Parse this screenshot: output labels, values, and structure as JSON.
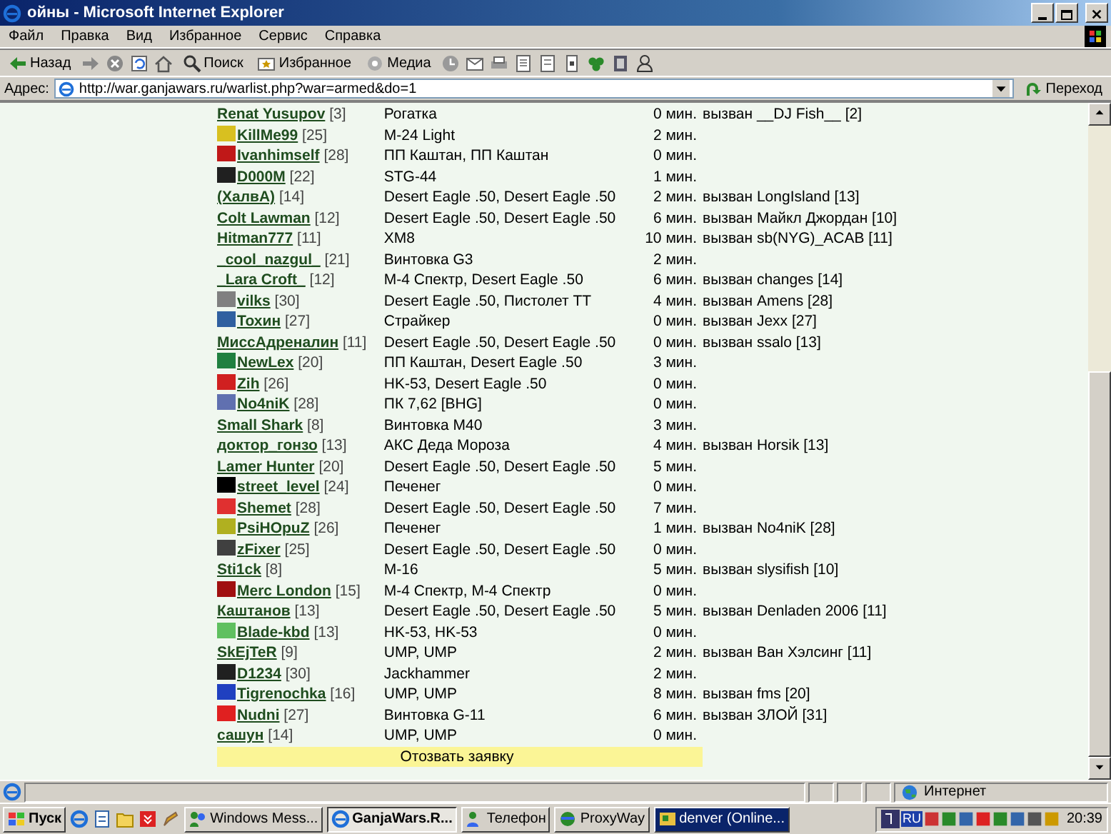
{
  "window": {
    "title": "ойны - Microsoft Internet Explorer"
  },
  "menu": [
    "Файл",
    "Правка",
    "Вид",
    "Избранное",
    "Сервис",
    "Справка"
  ],
  "toolbar": {
    "back": "Назад",
    "search": "Поиск",
    "favorites": "Избранное",
    "media": "Медиа"
  },
  "address": {
    "label": "Адрес:",
    "value": "http://war.ganjawars.ru/warlist.php?war=armed&do=1",
    "go": "Переход"
  },
  "rows": [
    {
      "name": "Renat Yusupov",
      "level": "[3]",
      "weapon": "Рогатка",
      "time": "0 мин.",
      "challenge": "вызван __DJ Fish__ [2]"
    },
    {
      "name": "KillMe99",
      "level": "[25]",
      "emblem": {
        "color": "#d8c020"
      },
      "weapon": "M-24 Light",
      "time": "2 мин."
    },
    {
      "name": "Ivanhimself",
      "level": "[28]",
      "emblem": {
        "color": "#c01818"
      },
      "weapon": "ПП Каштан, ПП Каштан",
      "time": "0 мин."
    },
    {
      "name": "D000M",
      "level": "[22]",
      "emblem": {
        "color": "#202020"
      },
      "weapon": "STG-44",
      "time": "1 мин."
    },
    {
      "name": "(ХалвА)",
      "level": "[14]",
      "weapon": "Desert Eagle .50, Desert Eagle .50",
      "time": "2 мин.",
      "challenge": "вызван LongIsland [13]"
    },
    {
      "name": "Colt Lawman",
      "level": "[12]",
      "weapon": "Desert Eagle .50, Desert Eagle .50",
      "time": "6 мин.",
      "challenge": "вызван Майкл Джордан [10]"
    },
    {
      "name": "Hitman777",
      "level": "[11]",
      "weapon": "XM8",
      "time": "10 мин.",
      "challenge": "вызван sb(NYG)_ACAB [11]"
    },
    {
      "name": "_cool_nazgul_",
      "level": "[21]",
      "weapon": "Винтовка G3",
      "time": "2 мин."
    },
    {
      "name": "_Lara Croft_",
      "level": "[12]",
      "weapon": "M-4 Спектр, Desert Eagle .50",
      "time": "6 мин.",
      "challenge": "вызван changes [14]"
    },
    {
      "name": "vilks",
      "level": "[30]",
      "emblem": {
        "color": "#808080"
      },
      "weapon": "Desert Eagle .50, Пистолет ТТ",
      "time": "4 мин.",
      "challenge": "вызван Amens [28]"
    },
    {
      "name": "Тохин",
      "level": "[27]",
      "emblem": {
        "color": "#3060a0"
      },
      "weapon": "Страйкер",
      "time": "0 мин.",
      "challenge": "вызван Jexx [27]"
    },
    {
      "name": "МиссАдреналин",
      "level": "[11]",
      "weapon": "Desert Eagle .50, Desert Eagle .50",
      "time": "0 мин.",
      "challenge": "вызван ssalo [13]"
    },
    {
      "name": "NewLex",
      "level": "[20]",
      "emblem": {
        "color": "#208040"
      },
      "weapon": "ПП Каштан, Desert Eagle .50",
      "time": "3 мин."
    },
    {
      "name": "Zih",
      "level": "[26]",
      "emblem": {
        "color": "#d02020"
      },
      "weapon": "HK-53, Desert Eagle .50",
      "time": "0 мин."
    },
    {
      "name": "No4niK",
      "level": "[28]",
      "emblem": {
        "color": "#6070b0"
      },
      "weapon": "ПК 7,62 [BHG]",
      "time": "0 мин."
    },
    {
      "name": "Small Shark",
      "level": "[8]",
      "weapon": "Винтовка M40",
      "time": "3 мин."
    },
    {
      "name": "доктор_гонзо",
      "level": "[13]",
      "weapon": "АКС Деда Мороза",
      "time": "4 мин.",
      "challenge": "вызван Horsik [13]"
    },
    {
      "name": "Lamer Hunter",
      "level": "[20]",
      "weapon": "Desert Eagle .50, Desert Eagle .50",
      "time": "5 мин."
    },
    {
      "name": "street_level",
      "level": "[24]",
      "emblem": {
        "color": "#000000"
      },
      "weapon": "Печенег",
      "time": "0 мин."
    },
    {
      "name": "Shemet",
      "level": "[28]",
      "emblem": {
        "color": "#e03030"
      },
      "weapon": "Desert Eagle .50, Desert Eagle .50",
      "time": "7 мин."
    },
    {
      "name": "PsiHOpuZ",
      "level": "[26]",
      "emblem": {
        "color": "#b0b020"
      },
      "weapon": "Печенег",
      "time": "1 мин.",
      "challenge": "вызван No4niK [28]"
    },
    {
      "name": "zFixer",
      "level": "[25]",
      "emblem": {
        "color": "#404040"
      },
      "weapon": "Desert Eagle .50, Desert Eagle .50",
      "time": "0 мин."
    },
    {
      "name": "Sti1ck",
      "level": "[8]",
      "weapon": "M-16",
      "time": "5 мин.",
      "challenge": "вызван slysifish [10]"
    },
    {
      "name": "Merc London",
      "level": "[15]",
      "emblem": {
        "color": "#a01010"
      },
      "weapon": "M-4 Спектр, M-4 Спектр",
      "time": "0 мин."
    },
    {
      "name": "Каштанов",
      "level": "[13]",
      "weapon": "Desert Eagle .50, Desert Eagle .50",
      "time": "5 мин.",
      "challenge": "вызван Denladen 2006 [11]"
    },
    {
      "name": "Blade-kbd",
      "level": "[13]",
      "emblem": {
        "color": "#60c060"
      },
      "weapon": "HK-53, HK-53",
      "time": "0 мин."
    },
    {
      "name": "SkEjTeR",
      "level": "[9]",
      "weapon": "UMP, UMP",
      "time": "2 мин.",
      "challenge": "вызван Ван Хэлсинг [11]"
    },
    {
      "name": "D1234",
      "level": "[30]",
      "emblem": {
        "color": "#202020"
      },
      "weapon": "Jackhammer",
      "time": "2 мин."
    },
    {
      "name": "Tigrenochka",
      "level": "[16]",
      "emblem": {
        "color": "#2040c0"
      },
      "weapon": "UMP, UMP",
      "time": "8 мин.",
      "challenge": "вызван fms [20]"
    },
    {
      "name": "Nudni",
      "level": "[27]",
      "emblem": {
        "color": "#e02020"
      },
      "weapon": "Винтовка G-11",
      "time": "6 мин.",
      "challenge": "вызван ЗЛОЙ [31]"
    },
    {
      "name": "сашун",
      "level": "[14]",
      "weapon": "UMP, UMP",
      "time": "0 мин."
    }
  ],
  "withdraw_link": "Отозвать заявку",
  "status_bar": {
    "zone": "Интернет"
  },
  "taskbar": {
    "start": "Пуск",
    "tasks": [
      {
        "label": "Windows Mess...",
        "selected": false,
        "flashing": false
      },
      {
        "label": "GanjaWars.R...",
        "selected": true,
        "flashing": false
      },
      {
        "label": "Телефон",
        "selected": false,
        "flashing": false
      },
      {
        "label": "ProxyWay",
        "selected": false,
        "flashing": false
      },
      {
        "label": "denver (Online...",
        "selected": false,
        "flashing": true
      }
    ],
    "language": "RU",
    "clock": "20:39"
  }
}
